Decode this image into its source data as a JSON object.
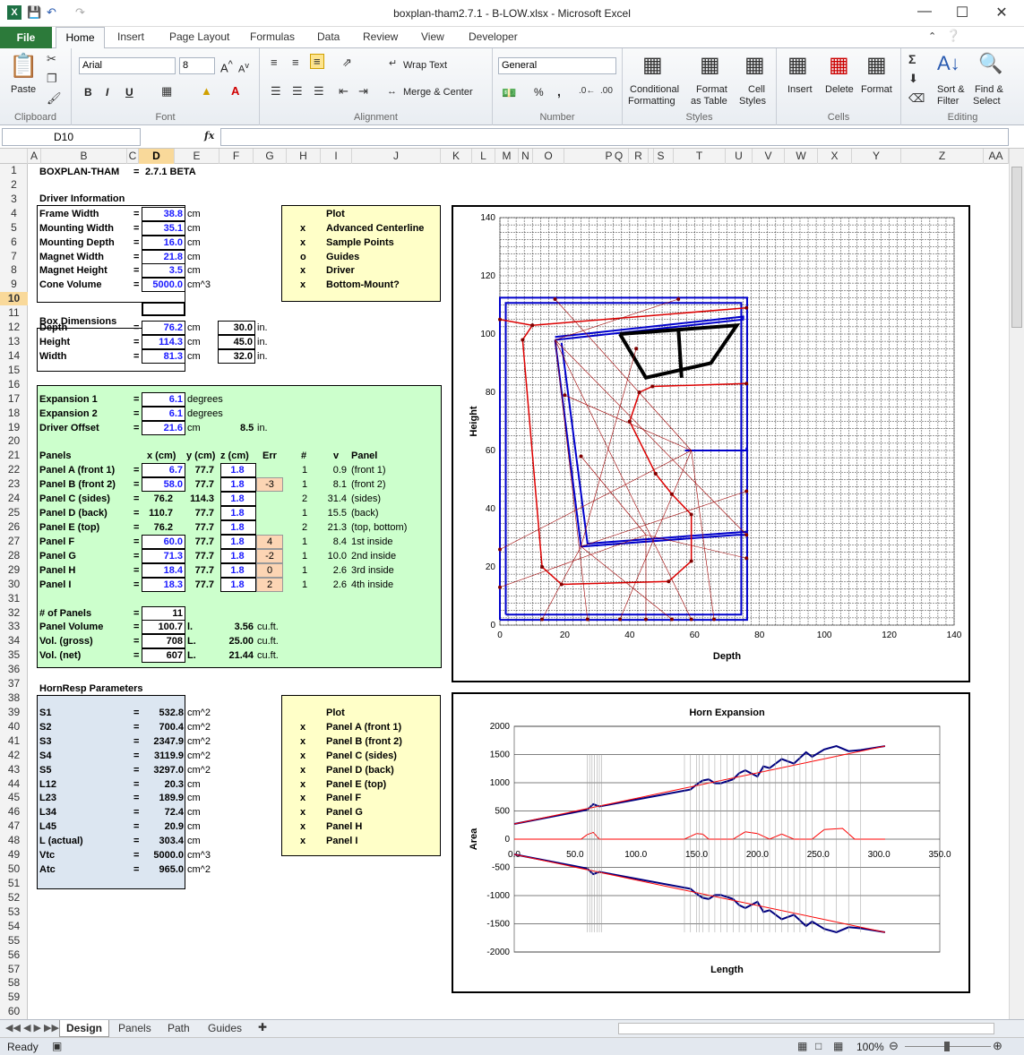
{
  "window": {
    "title": "boxplan-tham2.7.1 - B-LOW.xlsx - Microsoft Excel",
    "minimize": "—",
    "maximize": "☐",
    "close": "✕"
  },
  "tabs": [
    "File",
    "Home",
    "Insert",
    "Page Layout",
    "Formulas",
    "Data",
    "Review",
    "View",
    "Developer"
  ],
  "ribbon": {
    "clipboard": {
      "label": "Clipboard",
      "paste": "Paste"
    },
    "font": {
      "label": "Font",
      "name": "Arial",
      "size": "8",
      "bold": "B",
      "italic": "I",
      "underline": "U"
    },
    "alignment": {
      "label": "Alignment",
      "wrap": "Wrap Text",
      "merge": "Merge & Center"
    },
    "number": {
      "label": "Number",
      "format": "General",
      "percent": "%",
      "comma": ","
    },
    "styles": {
      "label": "Styles",
      "cond1": "Conditional",
      "cond2": "Formatting",
      "fmt1": "Format",
      "fmt2": "as Table",
      "cell1": "Cell",
      "cell2": "Styles"
    },
    "cells": {
      "label": "Cells",
      "insert": "Insert",
      "delete": "Delete",
      "format": "Format"
    },
    "editing": {
      "label": "Editing",
      "sort1": "Sort &",
      "sort2": "Filter",
      "find1": "Find &",
      "find2": "Select"
    }
  },
  "formula_bar": {
    "name_box": "D10",
    "fx": "fx",
    "value": ""
  },
  "columns": [
    "A",
    "B",
    "C",
    "D",
    "E",
    "F",
    "G",
    "H",
    "I",
    "J",
    "K",
    "L",
    "M",
    "N",
    "O",
    "P",
    "Q",
    "R",
    "S",
    "T",
    "U",
    "V",
    "W",
    "X",
    "Y",
    "Z",
    "AA"
  ],
  "sheet": {
    "title": "BOXPLAN-THAM",
    "eq": "=",
    "version": "2.7.1 BETA",
    "driver_header": "Driver Information",
    "driver": [
      {
        "label": "Frame Width",
        "value": "38.8",
        "unit": "cm"
      },
      {
        "label": "Mounting Width",
        "value": "35.1",
        "unit": "cm"
      },
      {
        "label": "Mounting Depth",
        "value": "16.0",
        "unit": "cm"
      },
      {
        "label": "Magnet Width",
        "value": "21.8",
        "unit": "cm"
      },
      {
        "label": "Magnet Height",
        "value": "3.5",
        "unit": "cm"
      },
      {
        "label": "Cone Volume",
        "value": "5000.0",
        "unit": "cm^3"
      }
    ],
    "plot1": {
      "header": "Plot",
      "rows": [
        {
          "mark": "x",
          "label": "Advanced Centerline"
        },
        {
          "mark": "x",
          "label": "Sample Points"
        },
        {
          "mark": "o",
          "label": "Guides"
        },
        {
          "mark": "x",
          "label": "Driver"
        },
        {
          "mark": "x",
          "label": "Bottom-Mount?"
        }
      ]
    },
    "box_header": "Box Dimensions",
    "box": [
      {
        "label": "Depth",
        "value": "76.2",
        "unit": "cm",
        "in": "30.0",
        "inunit": "in."
      },
      {
        "label": "Height",
        "value": "114.3",
        "unit": "cm",
        "in": "45.0",
        "inunit": "in."
      },
      {
        "label": "Width",
        "value": "81.3",
        "unit": "cm",
        "in": "32.0",
        "inunit": "in."
      }
    ],
    "expansion": [
      {
        "label": "Expansion 1",
        "value": "6.1",
        "unit": "degrees"
      },
      {
        "label": "Expansion 2",
        "value": "6.1",
        "unit": "degrees"
      },
      {
        "label": "Driver Offset",
        "value": "21.6",
        "unit": "cm",
        "extra": "8.5",
        "extraunit": "in."
      }
    ],
    "panel_headers": [
      "Panels",
      "x (cm)",
      "y (cm)",
      "z (cm)",
      "Err",
      "#",
      "v",
      "Panel"
    ],
    "panels": [
      {
        "name": "Panel A (front 1)",
        "x": "6.7",
        "y": "77.7",
        "z": "1.8",
        "err": "",
        "n": "1",
        "v": "0.9",
        "desc": "(front 1)",
        "xin": true
      },
      {
        "name": "Panel B (front 2)",
        "x": "58.0",
        "y": "77.7",
        "z": "1.8",
        "err": "-3",
        "n": "1",
        "v": "8.1",
        "desc": "(front 2)",
        "xin": true
      },
      {
        "name": "Panel C (sides)",
        "x": "76.2",
        "y": "114.3",
        "z": "1.8",
        "err": "",
        "n": "2",
        "v": "31.4",
        "desc": "(sides)",
        "xin": false
      },
      {
        "name": "Panel D (back)",
        "x": "110.7",
        "y": "77.7",
        "z": "1.8",
        "err": "",
        "n": "1",
        "v": "15.5",
        "desc": "(back)",
        "xin": false
      },
      {
        "name": "Panel E (top)",
        "x": "76.2",
        "y": "77.7",
        "z": "1.8",
        "err": "",
        "n": "2",
        "v": "21.3",
        "desc": "(top, bottom)",
        "xin": false
      },
      {
        "name": "Panel F",
        "x": "60.0",
        "y": "77.7",
        "z": "1.8",
        "err": "4",
        "n": "1",
        "v": "8.4",
        "desc": "1st inside",
        "xin": true
      },
      {
        "name": "Panel G",
        "x": "71.3",
        "y": "77.7",
        "z": "1.8",
        "err": "-2",
        "n": "1",
        "v": "10.0",
        "desc": "2nd inside",
        "xin": true
      },
      {
        "name": "Panel H",
        "x": "18.4",
        "y": "77.7",
        "z": "1.8",
        "err": "0",
        "n": "1",
        "v": "2.6",
        "desc": "3rd inside",
        "xin": true
      },
      {
        "name": "Panel I",
        "x": "18.3",
        "y": "77.7",
        "z": "1.8",
        "err": "2",
        "n": "1",
        "v": "2.6",
        "desc": "4th inside",
        "xin": true
      }
    ],
    "summary": [
      {
        "label": "# of Panels",
        "value": "11",
        "unit": "",
        "v2": "",
        "u2": ""
      },
      {
        "label": "Panel Volume",
        "value": "100.7",
        "unit": "l.",
        "v2": "3.56",
        "u2": "cu.ft."
      },
      {
        "label": "Vol. (gross)",
        "value": "708",
        "unit": "L.",
        "v2": "25.00",
        "u2": "cu.ft."
      },
      {
        "label": "Vol. (net)",
        "value": "607",
        "unit": "L.",
        "v2": "21.44",
        "u2": "cu.ft."
      }
    ],
    "hornresp_header": "HornResp Parameters",
    "hornresp": [
      {
        "label": "S1",
        "value": "532.8",
        "unit": "cm^2"
      },
      {
        "label": "S2",
        "value": "700.4",
        "unit": "cm^2"
      },
      {
        "label": "S3",
        "value": "2347.9",
        "unit": "cm^2"
      },
      {
        "label": "S4",
        "value": "3119.9",
        "unit": "cm^2"
      },
      {
        "label": "S5",
        "value": "3297.0",
        "unit": "cm^2"
      },
      {
        "label": "L12",
        "value": "20.3",
        "unit": "cm"
      },
      {
        "label": "L23",
        "value": "189.9",
        "unit": "cm"
      },
      {
        "label": "L34",
        "value": "72.4",
        "unit": "cm"
      },
      {
        "label": "L45",
        "value": "20.9",
        "unit": "cm"
      },
      {
        "label": "L (actual)",
        "value": "303.4",
        "unit": "cm"
      },
      {
        "label": "Vtc",
        "value": "5000.0",
        "unit": "cm^3"
      },
      {
        "label": "Atc",
        "value": "965.0",
        "unit": "cm^2"
      }
    ],
    "plot2": {
      "header": "Plot",
      "rows": [
        {
          "mark": "x",
          "label": "Panel A (front 1)"
        },
        {
          "mark": "x",
          "label": "Panel B (front 2)"
        },
        {
          "mark": "x",
          "label": "Panel C (sides)"
        },
        {
          "mark": "x",
          "label": "Panel D (back)"
        },
        {
          "mark": "x",
          "label": "Panel E (top)"
        },
        {
          "mark": "x",
          "label": "Panel F"
        },
        {
          "mark": "x",
          "label": "Panel G"
        },
        {
          "mark": "x",
          "label": "Panel H"
        },
        {
          "mark": "x",
          "label": "Panel I"
        }
      ]
    }
  },
  "chart_data": [
    {
      "type": "line",
      "title": "",
      "xlabel": "Depth",
      "ylabel": "Height",
      "xlim": [
        0,
        140
      ],
      "ylim": [
        0,
        140
      ],
      "xticks": [
        "0",
        "20",
        "40",
        "60",
        "80",
        "100",
        "120",
        "140"
      ],
      "yticks": [
        "0",
        "20",
        "40",
        "60",
        "80",
        "100",
        "120",
        "140"
      ],
      "grid": true,
      "series": [
        {
          "color": "#0000cc",
          "x": [
            0,
            76.2,
            76.2,
            0,
            0
          ],
          "y": [
            1.8,
            1.8,
            112.5,
            112.5,
            1.8
          ]
        },
        {
          "color": "#0000cc",
          "x": [
            1.8,
            74.4,
            74.4,
            1.8,
            1.8
          ],
          "y": [
            3.6,
            3.6,
            110.7,
            110.7,
            3.6
          ]
        },
        {
          "color": "#0000cc",
          "x": [
            17,
            75,
            75,
            17
          ],
          "y": [
            98,
            105,
            106,
            99
          ]
        },
        {
          "color": "#0000cc",
          "x": [
            17,
            25,
            73,
            76
          ],
          "y": [
            98,
            27,
            31,
            31
          ]
        },
        {
          "color": "#0000cc",
          "x": [
            19,
            27,
            75,
            76
          ],
          "y": [
            97,
            28,
            32,
            32
          ]
        },
        {
          "color": "#0000cc",
          "x": [
            57,
            76,
            76
          ],
          "y": [
            60,
            60,
            61
          ]
        },
        {
          "color": "#dd0000",
          "x": [
            0,
            10,
            7,
            13,
            19,
            52,
            59,
            59,
            53,
            48,
            40,
            43,
            47,
            76
          ],
          "y": [
            105,
            103,
            98,
            20,
            14,
            15,
            22,
            38,
            45,
            52,
            70,
            80,
            82,
            83
          ]
        },
        {
          "color": "#dd0000",
          "x": [
            10,
            76
          ],
          "y": [
            103,
            109
          ]
        },
        {
          "color": "#000000",
          "x": [
            37,
            73,
            65,
            45,
            37
          ],
          "y": [
            100,
            103,
            90,
            85,
            100
          ]
        },
        {
          "color": "#000000",
          "x": [
            55,
            56
          ],
          "y": [
            102,
            85
          ]
        }
      ]
    },
    {
      "type": "line",
      "title": "Horn Expansion",
      "xlabel": "Length",
      "ylabel": "Area",
      "xlim": [
        0,
        350
      ],
      "ylim": [
        -2000,
        2000
      ],
      "xticks": [
        "0.0",
        "50.0",
        "100.0",
        "150.0",
        "200.0",
        "250.0",
        "300.0",
        "350.0"
      ],
      "yticks": [
        "-2000",
        "-1500",
        "-1000",
        "-500",
        "0",
        "500",
        "1000",
        "1500",
        "2000"
      ],
      "grid": true,
      "series": [
        {
          "color": "#000080",
          "x": [
            0,
            60,
            65,
            70,
            145,
            150,
            155,
            160,
            165,
            170,
            180,
            185,
            190,
            200,
            205,
            210,
            220,
            230,
            240,
            245,
            255,
            265,
            275,
            285,
            305
          ],
          "y": [
            270,
            520,
            620,
            580,
            880,
            970,
            1040,
            1060,
            990,
            990,
            1060,
            1170,
            1220,
            1110,
            1290,
            1260,
            1420,
            1340,
            1540,
            1460,
            1590,
            1650,
            1560,
            1580,
            1650
          ]
        },
        {
          "color": "#ff0000",
          "x": [
            0,
            305
          ],
          "y": [
            270,
            1650
          ]
        },
        {
          "color": "#ff0000",
          "x": [
            0,
            55,
            60,
            65,
            70,
            140,
            150,
            155,
            160,
            180,
            190,
            200,
            210,
            220,
            230,
            245,
            255,
            270,
            280,
            305
          ],
          "y": [
            0,
            0,
            80,
            120,
            0,
            0,
            100,
            90,
            0,
            0,
            130,
            100,
            0,
            90,
            0,
            0,
            170,
            190,
            0,
            0
          ]
        },
        {
          "color": "#000080",
          "x": [
            0,
            60,
            65,
            70,
            145,
            150,
            155,
            160,
            165,
            170,
            180,
            185,
            190,
            200,
            205,
            210,
            220,
            230,
            240,
            245,
            255,
            265,
            275,
            285,
            305
          ],
          "y": [
            -270,
            -520,
            -620,
            -580,
            -880,
            -970,
            -1040,
            -1060,
            -990,
            -990,
            -1060,
            -1170,
            -1220,
            -1110,
            -1290,
            -1260,
            -1420,
            -1340,
            -1540,
            -1460,
            -1590,
            -1650,
            -1560,
            -1580,
            -1650
          ]
        },
        {
          "color": "#ff0000",
          "x": [
            0,
            305
          ],
          "y": [
            -270,
            -1650
          ]
        }
      ]
    }
  ],
  "sheet_tabs": [
    "Design",
    "Panels",
    "Path",
    "Guides"
  ],
  "status": {
    "ready": "Ready",
    "zoom": "100%"
  }
}
